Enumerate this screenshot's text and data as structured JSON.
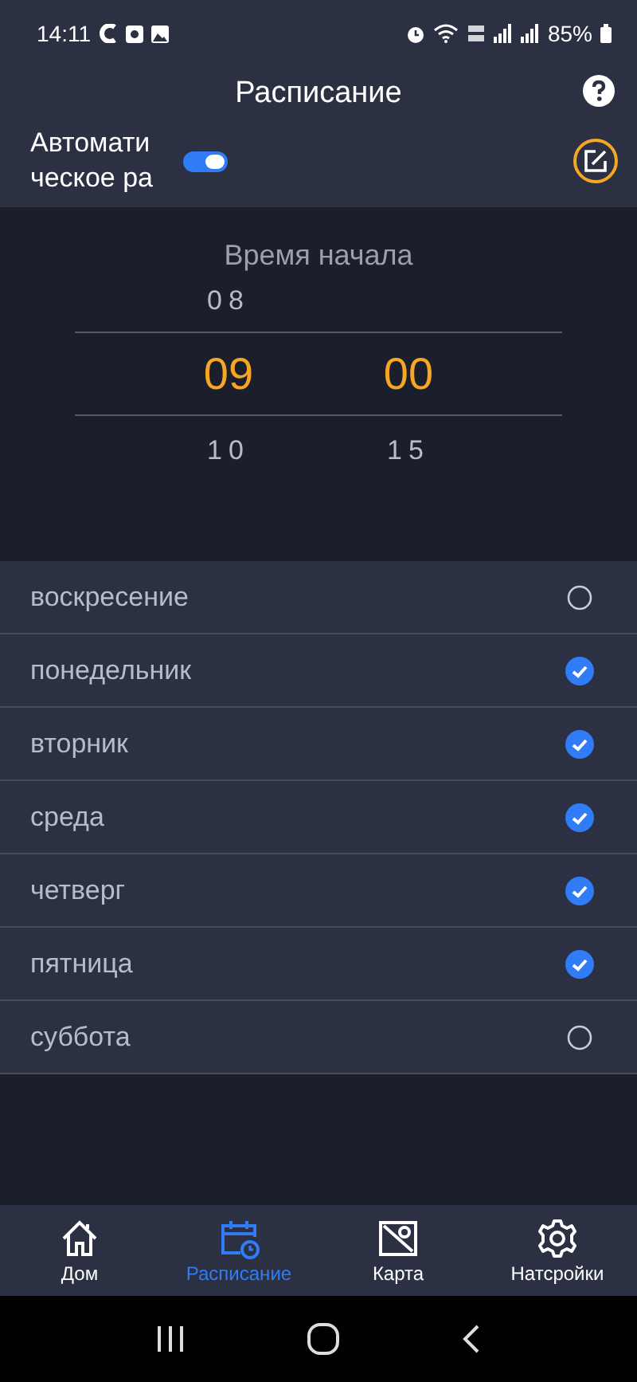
{
  "status_bar": {
    "time": "14:11",
    "battery": "85%"
  },
  "header": {
    "title": "Расписание"
  },
  "auto_schedule": {
    "label_lines": [
      "Автомати",
      "ческое ра"
    ],
    "on": true
  },
  "time_picker": {
    "title": "Время начала",
    "wheels": [
      {
        "above": "08",
        "current": "09",
        "below": "10"
      },
      {
        "current": "00",
        "below": "15"
      }
    ]
  },
  "days": [
    {
      "label": "воскресение",
      "checked": false
    },
    {
      "label": "понедельник",
      "checked": true
    },
    {
      "label": "вторник",
      "checked": true
    },
    {
      "label": "среда",
      "checked": true
    },
    {
      "label": "четверг",
      "checked": true
    },
    {
      "label": "пятница",
      "checked": true
    },
    {
      "label": "суббота",
      "checked": false
    }
  ],
  "bottom_nav": [
    {
      "kind": "home",
      "label": "Дом",
      "selected": false
    },
    {
      "kind": "schedule",
      "label": "Расписание",
      "selected": true
    },
    {
      "kind": "map",
      "label": "Карта",
      "selected": false
    },
    {
      "kind": "settings",
      "label": "Натсройки",
      "selected": false
    }
  ]
}
